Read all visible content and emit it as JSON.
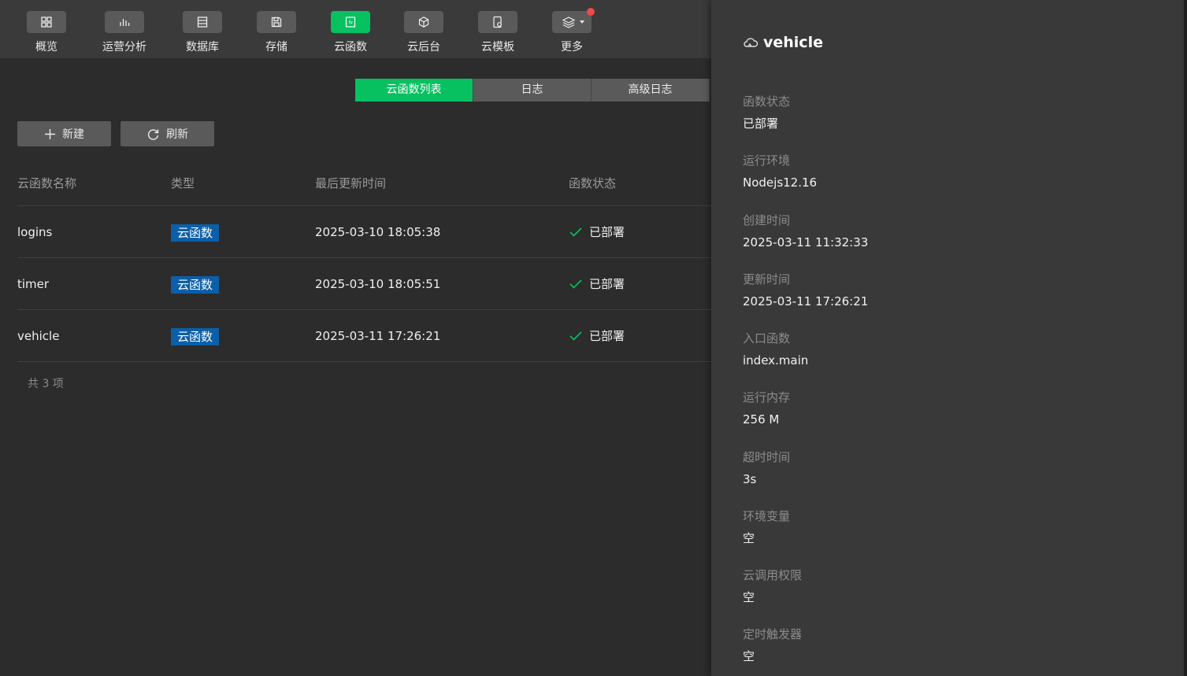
{
  "toolbar": {
    "items": [
      {
        "label": "概览",
        "icon": "overview-grid-icon"
      },
      {
        "label": "运营分析",
        "icon": "bar-chart-icon"
      },
      {
        "label": "数据库",
        "icon": "database-icon"
      },
      {
        "label": "存储",
        "icon": "storage-save-icon"
      },
      {
        "label": "云函数",
        "icon": "cloud-function-icon"
      },
      {
        "label": "云后台",
        "icon": "cube-icon"
      },
      {
        "label": "云模板",
        "icon": "template-icon"
      },
      {
        "label": "更多",
        "icon": "layers-icon"
      }
    ],
    "active_index": 4
  },
  "tabs": [
    "云函数列表",
    "日志",
    "高级日志"
  ],
  "actions": {
    "new_label": "新建",
    "refresh_label": "刷新"
  },
  "table": {
    "headers": [
      "云函数名称",
      "类型",
      "最后更新时间",
      "函数状态"
    ],
    "rows": [
      {
        "name": "logins",
        "type": "云函数",
        "updated": "2025-03-10 18:05:38",
        "status": "已部署"
      },
      {
        "name": "timer",
        "type": "云函数",
        "updated": "2025-03-10 18:05:51",
        "status": "已部署"
      },
      {
        "name": "vehicle",
        "type": "云函数",
        "updated": "2025-03-11 17:26:21",
        "status": "已部署"
      }
    ],
    "total": "共 3 项"
  },
  "detail": {
    "title": "vehicle",
    "fields": [
      {
        "label": "函数状态",
        "value": "已部署"
      },
      {
        "label": "运行环境",
        "value": "Nodejs12.16"
      },
      {
        "label": "创建时间",
        "value": "2025-03-11 11:32:33"
      },
      {
        "label": "更新时间",
        "value": "2025-03-11 17:26:21"
      },
      {
        "label": "入口函数",
        "value": "index.main"
      },
      {
        "label": "运行内存",
        "value": "256 M"
      },
      {
        "label": "超时时间",
        "value": "3s"
      },
      {
        "label": "环境变量",
        "value": "空"
      },
      {
        "label": "云调用权限",
        "value": "空"
      },
      {
        "label": "定时触发器",
        "value": "空"
      }
    ]
  },
  "colors": {
    "accent": "#07c160",
    "tag": "#0b5fa8",
    "notify": "#f0484b"
  }
}
